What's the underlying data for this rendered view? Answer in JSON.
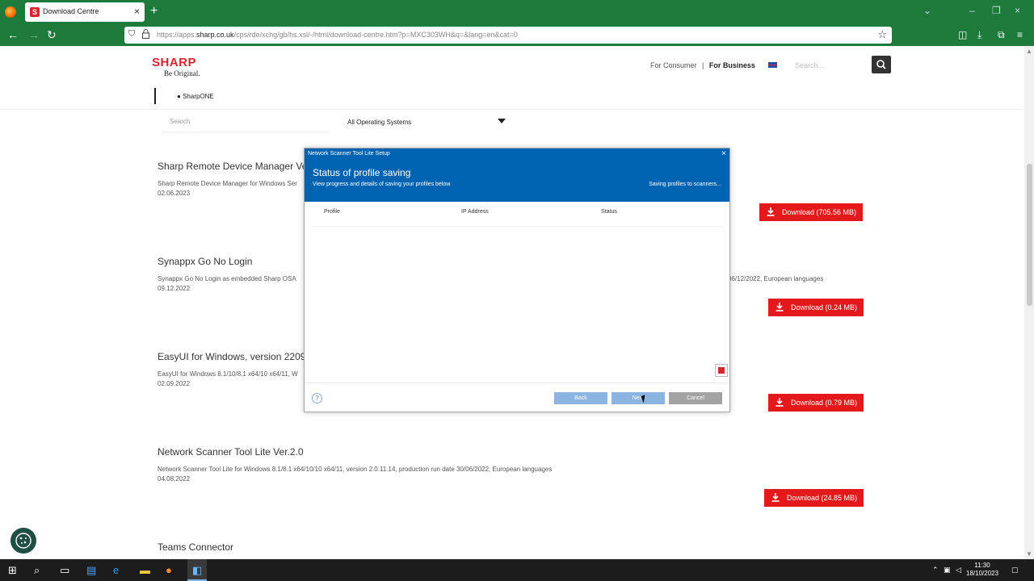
{
  "browser": {
    "tab_title": "Download Centre",
    "tab_favicon": "S",
    "new_tab": "+",
    "url_prefix": "https://apps.",
    "url_domain": "sharp.co.uk",
    "url_rest": "/cps/rde/xchg/gb/hs.xsl/-/html/download-centre.htm?p=MXC303WH&q=&lang=en&cat=0"
  },
  "header": {
    "brand": "SHARP",
    "tagline": "Be Original.",
    "for_consumer": "For Consumer",
    "separator": "|",
    "for_business": "For Business",
    "search_placeholder": "Search...",
    "sharpone": "SharpONE"
  },
  "filters": {
    "search_placeholder": "Search",
    "os_selected": "All Operating Systems"
  },
  "entries": [
    {
      "title": "Sharp Remote Device Manager Ve",
      "desc": "Sharp Remote Device Manager for Windows Ser",
      "date": "02.06.2023",
      "download": "Download (705.56 MB)",
      "desc_tail": ""
    },
    {
      "title": "Synappx Go No Login",
      "desc": "Synappx Go No Login as embedded Sharp OSA",
      "date": "09.12.2022",
      "download": "Download (0.24 MB)",
      "desc_tail": "06/12/2022, European languages"
    },
    {
      "title": "EasyUI for Windows, version 2209",
      "desc": "EasyUI for Windows 8.1/10/8.1 x64/10 x64/11, W",
      "date": "02.09.2022",
      "download": "Download (0.79 MB)",
      "desc_tail": ""
    },
    {
      "title": "Network Scanner Tool Lite Ver.2.0",
      "desc": "Network Scanner Tool Lite for Windows 8.1/8.1 x64/10/10 x64/11, version 2.0.11.14, production run date 30/06/2022, European languages",
      "date": "04.08.2022",
      "download": "Download (24.85 MB)",
      "desc_tail": ""
    },
    {
      "title": "Teams Connector",
      "desc": "",
      "date": "",
      "download": "",
      "desc_tail": ""
    }
  ],
  "dialog": {
    "window_title": "Network Scanner Tool Lite Setup",
    "heading": "Status of profile saving",
    "subtitle": "View progress and details of saving your profiles below.",
    "status_text": "Saving profiles to scanners...",
    "columns": [
      "Profile",
      "IP Address",
      "Status"
    ],
    "help": "?",
    "back": "Back",
    "next": "Next",
    "cancel": "Cancel"
  },
  "taskbar": {
    "time": "11:30",
    "date": "18/10/2023"
  },
  "colors": {
    "browser_green": "#1e7a3a",
    "sharp_red": "#d7262f",
    "download_red": "#e3191b",
    "dialog_blue": "#0063b1"
  }
}
